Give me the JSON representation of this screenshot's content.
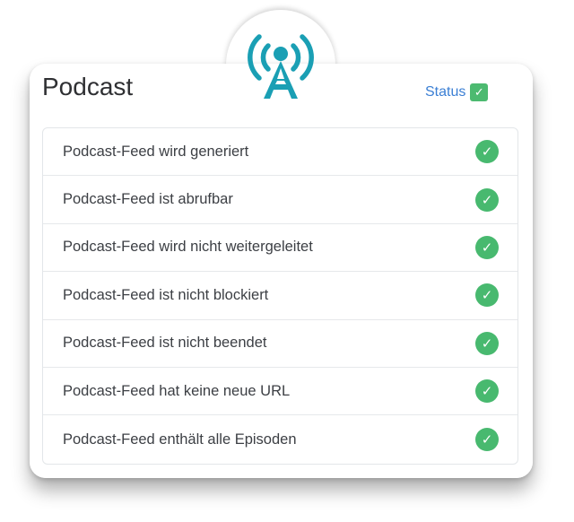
{
  "header": {
    "title": "Podcast",
    "status_label": "Status",
    "status_check": "✓"
  },
  "icon": {
    "name": "broadcast-tower-icon",
    "color": "#1a9fb4"
  },
  "checks": {
    "items": [
      {
        "label": "Podcast-Feed wird generiert",
        "ok": "✓"
      },
      {
        "label": "Podcast-Feed ist abrufbar",
        "ok": "✓"
      },
      {
        "label": "Podcast-Feed wird nicht weitergeleitet",
        "ok": "✓"
      },
      {
        "label": "Podcast-Feed ist nicht blockiert",
        "ok": "✓"
      },
      {
        "label": "Podcast-Feed ist nicht beendet",
        "ok": "✓"
      },
      {
        "label": "Podcast-Feed hat keine neue URL",
        "ok": "✓"
      },
      {
        "label": "Podcast-Feed enthält alle Episoden",
        "ok": "✓"
      }
    ]
  },
  "colors": {
    "accent_link": "#3b7fd4",
    "success": "#48b96f",
    "icon": "#1a9fb4"
  }
}
